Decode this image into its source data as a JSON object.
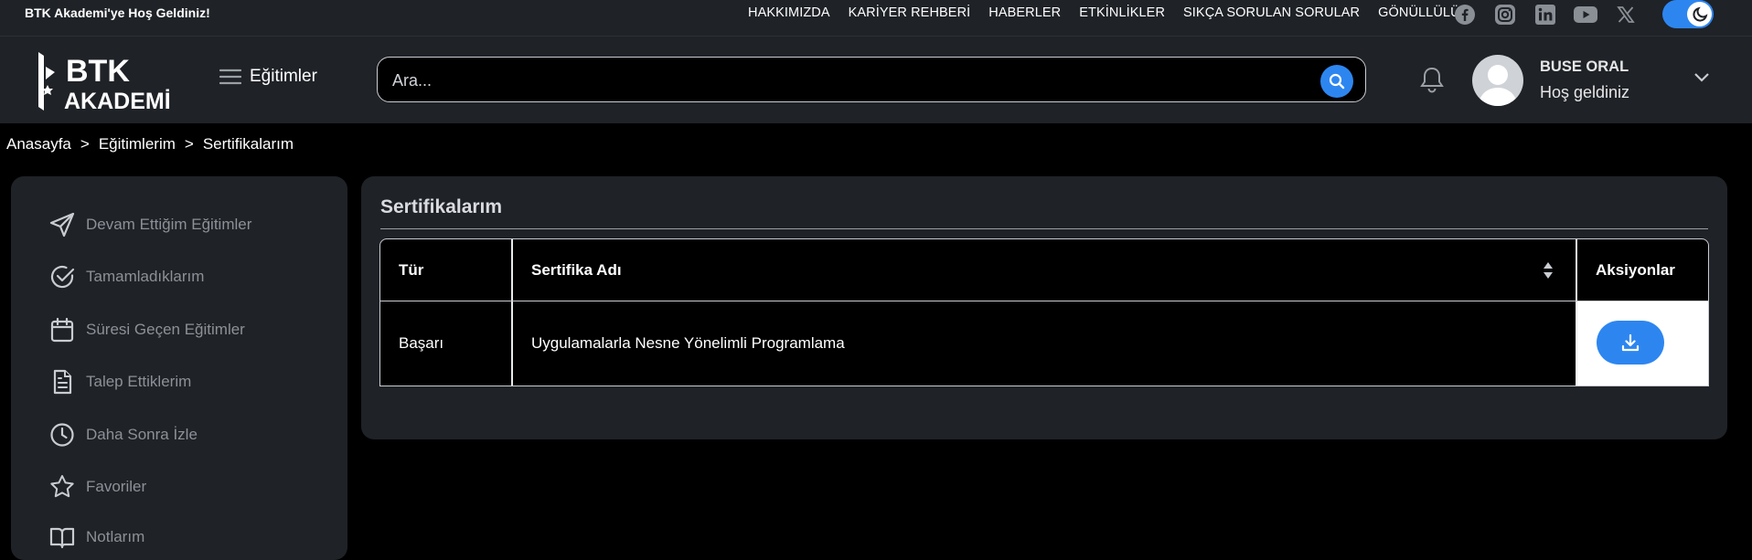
{
  "topbar": {
    "welcome": "BTK Akademi'ye Hoş Geldiniz!",
    "links": [
      "HAKKIMIZDA",
      "KARİYER REHBERİ",
      "HABERLER",
      "ETKİNLİKLER",
      "SIKÇA SORULAN SORULAR",
      "GÖNÜLLÜLÜK"
    ],
    "socials": [
      "facebook-icon",
      "instagram-icon",
      "linkedin-icon",
      "youtube-icon",
      "x-icon"
    ],
    "theme_toggle": "moon-icon"
  },
  "header": {
    "logo_top": "BTK",
    "logo_bottom": "AKADEMİ",
    "menu_label": "Eğitimler",
    "search_placeholder": "Ara...",
    "user_name": "BUSE ORAL",
    "user_greeting": "Hoş geldiniz"
  },
  "breadcrumb": [
    "Anasayfa",
    "Eğitimlerim",
    "Sertifikalarım"
  ],
  "breadcrumb_sep": ">",
  "sidebar": {
    "items": [
      {
        "label": "Devam Ettiğim Eğitimler",
        "icon": "send-icon"
      },
      {
        "label": "Tamamladıklarım",
        "icon": "check-circle-icon"
      },
      {
        "label": "Süresi Geçen Eğitimler",
        "icon": "calendar-icon"
      },
      {
        "label": "Talep Ettiklerim",
        "icon": "document-icon"
      },
      {
        "label": "Daha Sonra İzle",
        "icon": "clock-icon"
      },
      {
        "label": "Favoriler",
        "icon": "star-icon"
      },
      {
        "label": "Notlarım",
        "icon": "book-icon"
      }
    ]
  },
  "main": {
    "title": "Sertifikalarım",
    "table": {
      "headers": [
        "Tür",
        "Sertifika Adı",
        "Aksiyonlar"
      ],
      "rows": [
        {
          "type": "Başarı",
          "name": "Uygulamalarla Nesne Yönelimli Programlama",
          "action_icon": "download-icon"
        }
      ]
    }
  },
  "colors": {
    "accent": "#2d86f0",
    "panel": "#1f2227",
    "background": "#000000"
  }
}
